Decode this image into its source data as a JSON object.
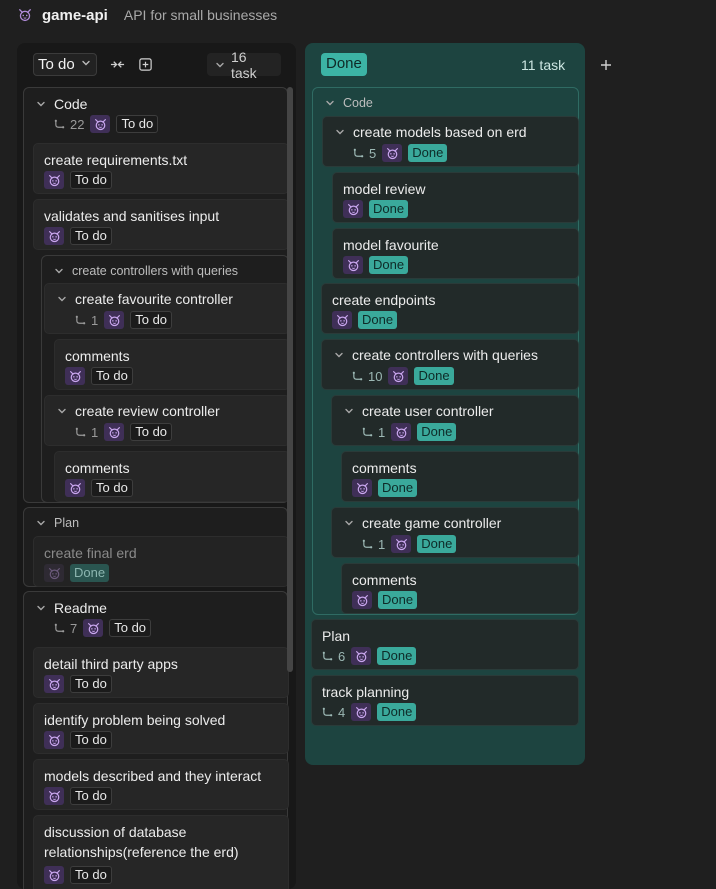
{
  "header": {
    "title": "game-api",
    "subtitle": "API for small businesses",
    "logo_icon": "cat-face-icon"
  },
  "todo_column": {
    "status": "To do",
    "count_label": "16 task",
    "groups": {
      "code": {
        "label": "Code",
        "subtasks": "22",
        "status": "To do",
        "cards": {
          "c1": {
            "title": "create requirements.txt",
            "status": "To do"
          },
          "c2": {
            "title": "validates and sanitises input",
            "status": "To do"
          }
        },
        "controllers": {
          "label": "create controllers with queries",
          "fav": {
            "title": "create favourite controller",
            "subtasks": "1",
            "status": "To do",
            "comments": {
              "title": "comments",
              "status": "To do"
            }
          },
          "review": {
            "title": "create review controller",
            "subtasks": "1",
            "status": "To do",
            "comments": {
              "title": "comments",
              "status": "To do"
            }
          }
        }
      },
      "plan": {
        "label": "Plan",
        "card": {
          "title": "create final erd",
          "status": "Done"
        }
      },
      "readme": {
        "label": "Readme",
        "subtasks": "7",
        "status": "To do",
        "cards": {
          "r1": {
            "title": "detail third party apps",
            "status": "To do"
          },
          "r2": {
            "title": "identify problem being solved",
            "status": "To do"
          },
          "r3": {
            "title": "models described and they interact",
            "status": "To do"
          },
          "r4": {
            "title_line1": "discussion of database",
            "title_line2": "relationships(reference the erd)",
            "status": "To do"
          }
        }
      }
    }
  },
  "done_column": {
    "status": "Done",
    "count_label": "11 task",
    "code_group": {
      "label": "Code",
      "models": {
        "title": "create models based on erd",
        "subtasks": "5",
        "status": "Done",
        "review": {
          "title": "model review",
          "status": "Done"
        },
        "fav": {
          "title": "model favourite",
          "status": "Done"
        }
      },
      "endpoints": {
        "title": "create endpoints",
        "status": "Done"
      },
      "controllers": {
        "title": "create controllers with queries",
        "subtasks": "10",
        "status": "Done",
        "user": {
          "title": "create user controller",
          "subtasks": "1",
          "status": "Done",
          "comments": {
            "title": "comments",
            "status": "Done"
          }
        },
        "game": {
          "title": "create game controller",
          "subtasks": "1",
          "status": "Done",
          "comments": {
            "title": "comments",
            "status": "Done"
          }
        }
      }
    },
    "plan": {
      "title": "Plan",
      "subtasks": "6",
      "status": "Done"
    },
    "track": {
      "title": "track planning",
      "subtasks": "4",
      "status": "Done"
    }
  },
  "colors": {
    "accent_done": "#3aa99b",
    "avatar_bg": "#3f2f57"
  }
}
